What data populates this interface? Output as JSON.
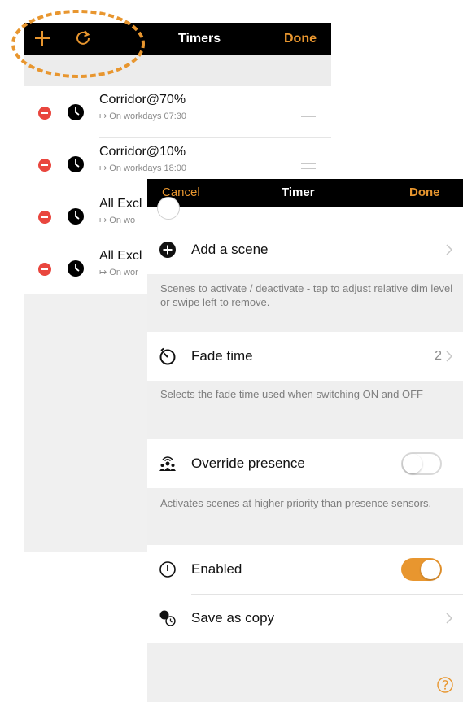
{
  "back": {
    "title": "Timers",
    "done_label": "Done",
    "timers": [
      {
        "name": "Corridor@70%",
        "schedule": "↦ On workdays 07:30"
      },
      {
        "name": "Corridor@10%",
        "schedule": "↦ On workdays 18:00"
      },
      {
        "name": "All Excl",
        "schedule": "↦ On wo"
      },
      {
        "name": "All Excl",
        "schedule": "↦ On wor"
      }
    ]
  },
  "front": {
    "title": "Timer",
    "cancel_label": "Cancel",
    "done_label": "Done",
    "add_scene_label": "Add a scene",
    "scenes_note": "Scenes to activate / deactivate - tap to adjust relative dim level or swipe left to remove.",
    "fade_time_label": "Fade time",
    "fade_time_value": "2",
    "fade_note": "Selects the fade time used when switching ON and OFF",
    "override_label": "Override presence",
    "override_on": false,
    "override_note": "Activates scenes at higher priority than presence sensors.",
    "enabled_label": "Enabled",
    "enabled_on": true,
    "save_copy_label": "Save as copy"
  },
  "colors": {
    "accent": "#e8962f",
    "delete": "#e9463e",
    "bar": "#000000"
  },
  "icons": [
    "plus-icon",
    "refresh-icon",
    "clock-icon",
    "add-circle-icon",
    "timer-icon",
    "presence-icon",
    "power-icon",
    "copy-icon",
    "help-icon",
    "chevron-right-icon",
    "reorder-icon"
  ]
}
